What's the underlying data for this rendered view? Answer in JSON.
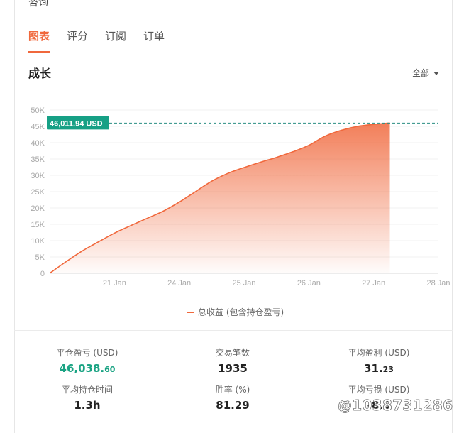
{
  "top_label": "咨询",
  "tabs": [
    {
      "label": "图表",
      "active": true
    },
    {
      "label": "评分",
      "active": false
    },
    {
      "label": "订阅",
      "active": false
    },
    {
      "label": "订单",
      "active": false
    }
  ],
  "section": {
    "title": "成长",
    "range_label": "全部"
  },
  "chart_data": {
    "type": "area",
    "series": [
      {
        "name": "总收益 (包含持仓盈亏)",
        "color": "#f0683c",
        "points": [
          [
            0,
            0
          ],
          [
            0.5,
            3500
          ],
          [
            1,
            6800
          ],
          [
            1.5,
            9600
          ],
          [
            2,
            12300
          ],
          [
            2.5,
            14600
          ],
          [
            3,
            16800
          ],
          [
            3.5,
            19000
          ],
          [
            4,
            21800
          ],
          [
            4.5,
            25000
          ],
          [
            5,
            28200
          ],
          [
            5.5,
            30600
          ],
          [
            6,
            32400
          ],
          [
            6.5,
            34000
          ],
          [
            7,
            35500
          ],
          [
            7.5,
            37200
          ],
          [
            8,
            39200
          ],
          [
            8.5,
            42000
          ],
          [
            9,
            43800
          ],
          [
            9.5,
            45000
          ],
          [
            10,
            45600
          ],
          [
            10.5,
            46011.94
          ]
        ]
      }
    ],
    "x_ticks": [
      {
        "label": "21 Jan",
        "x": 2
      },
      {
        "label": "24 Jan",
        "x": 4
      },
      {
        "label": "25 Jan",
        "x": 6
      },
      {
        "label": "26 Jan",
        "x": 8
      },
      {
        "label": "27 Jan",
        "x": 10
      },
      {
        "label": "28 Jan",
        "x": 12
      }
    ],
    "y_ticks": [
      "0",
      "5K",
      "10K",
      "15K",
      "20K",
      "25K",
      "30K",
      "35K",
      "40K",
      "45K",
      "50K"
    ],
    "ylim": [
      0,
      50000
    ],
    "xlim": [
      0,
      12
    ],
    "marker_value": 46011.94,
    "marker_label": "46,011.94 USD",
    "grid": true,
    "legend": "bottom-center"
  },
  "stats": {
    "closed_pnl": {
      "label": "平仓盈亏 (USD)",
      "int": "46,038.",
      "dec": "60"
    },
    "trades": {
      "label": "交易笔数",
      "value": "1935"
    },
    "avg_profit": {
      "label": "平均盈利 (USD)",
      "int": "31.",
      "dec": "23"
    },
    "avg_hold": {
      "label": "平均持仓时间",
      "value": "1.3h"
    },
    "win_rate": {
      "label": "胜率 (%)",
      "value": "81.29"
    },
    "avg_loss": {
      "label": "平均亏损 (USD)",
      "value": "-8.5"
    }
  },
  "watermark": "@1038731286"
}
